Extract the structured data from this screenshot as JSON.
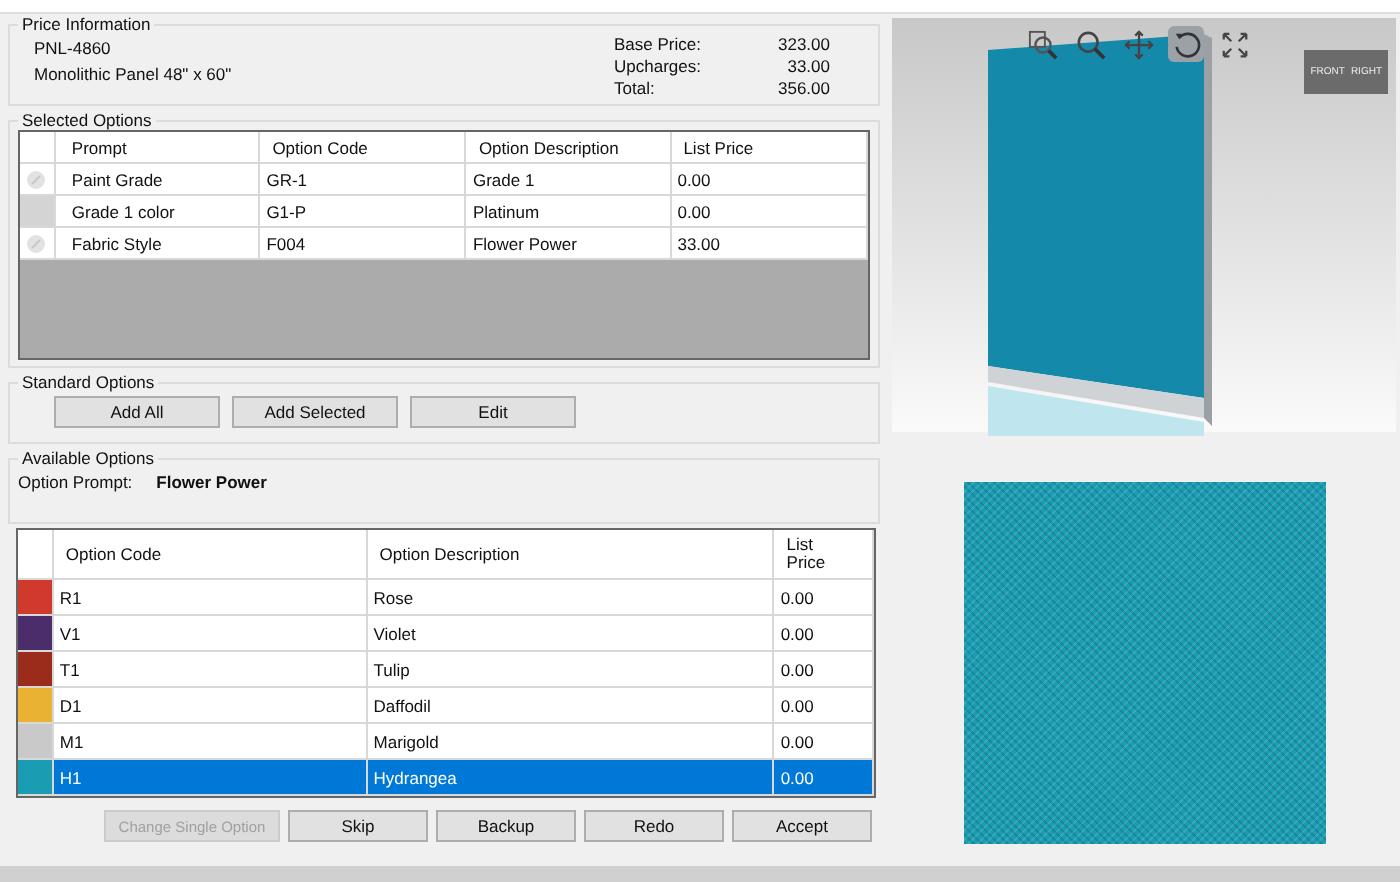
{
  "price_information": {
    "title": "Price Information",
    "part_number": "PNL-4860",
    "description": "Monolithic Panel 48\" x 60\"",
    "totals": [
      {
        "label": "Base Price:",
        "value": "323.00"
      },
      {
        "label": "Upcharges:",
        "value": "33.00"
      },
      {
        "label": "Total:",
        "value": "356.00"
      }
    ]
  },
  "selected_options": {
    "title": "Selected Options",
    "columns": [
      "Prompt",
      "Option Code",
      "Option Description",
      "List Price"
    ],
    "rows": [
      {
        "kind": "icon",
        "cells": [
          "Paint Grade",
          "GR-1",
          "Grade 1",
          "0.00"
        ]
      },
      {
        "kind": "blank",
        "cells": [
          "Grade 1 color",
          "G1-P",
          "Platinum",
          "0.00"
        ]
      },
      {
        "kind": "icon",
        "cells": [
          "Fabric Style",
          "F004",
          "Flower Power",
          "33.00"
        ]
      }
    ]
  },
  "standard_options": {
    "title": "Standard Options",
    "buttons": [
      "Add All",
      "Add Selected",
      "Edit"
    ]
  },
  "available_options": {
    "title": "Available Options",
    "prompt_label": "Option Prompt:",
    "prompt_value": "Flower Power",
    "columns": [
      "Option Code",
      "Option Description",
      "List\nPrice"
    ],
    "rows": [
      {
        "color": "#d03a2c",
        "selected": false,
        "cells": [
          "R1",
          "Rose",
          "0.00"
        ]
      },
      {
        "color": "#4b2d6b",
        "selected": false,
        "cells": [
          "V1",
          "Violet",
          "0.00"
        ]
      },
      {
        "color": "#9b2c1c",
        "selected": false,
        "cells": [
          "T1",
          "Tulip",
          "0.00"
        ]
      },
      {
        "color": "#e9b233",
        "selected": false,
        "cells": [
          "D1",
          "Daffodil",
          "0.00"
        ]
      },
      {
        "color": "#c9c9c9",
        "selected": false,
        "cells": [
          "M1",
          "Marigold",
          "0.00"
        ]
      },
      {
        "color": "#1a9cb3",
        "selected": true,
        "cells": [
          "H1",
          "Hydrangea",
          "0.00"
        ]
      }
    ]
  },
  "actions": [
    {
      "label": "Change Single Option",
      "disabled": true
    },
    {
      "label": "Skip",
      "disabled": false
    },
    {
      "label": "Backup",
      "disabled": false
    },
    {
      "label": "Redo",
      "disabled": false
    },
    {
      "label": "Accept",
      "disabled": false
    }
  ],
  "viewer": {
    "tools": [
      {
        "kind": "zoom-window",
        "selected": false
      },
      {
        "kind": "zoom",
        "selected": false
      },
      {
        "kind": "pan",
        "selected": false
      },
      {
        "kind": "rotate",
        "selected": true
      },
      {
        "kind": "extents",
        "selected": false
      }
    ],
    "cube_labels": [
      "FRONT",
      "RIGHT"
    ]
  }
}
